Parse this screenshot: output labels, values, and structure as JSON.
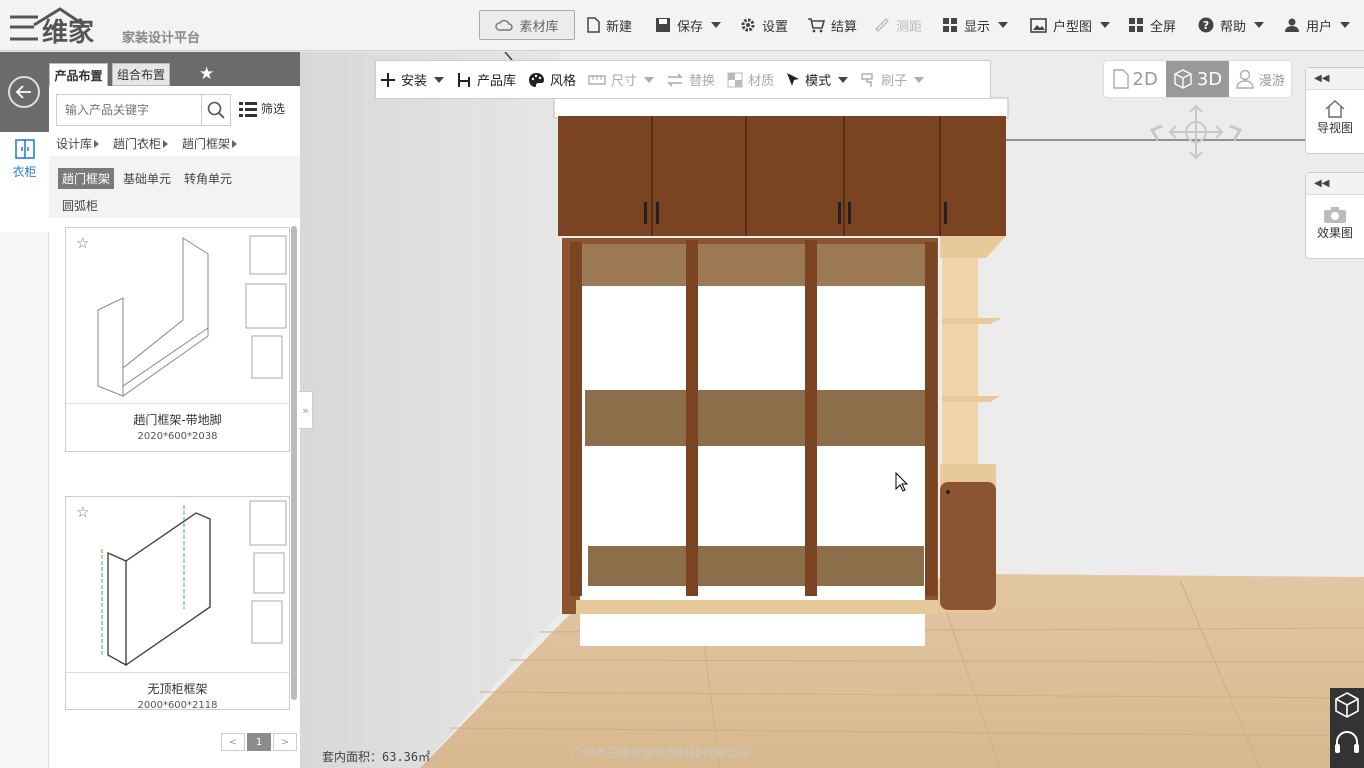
{
  "header": {
    "logo_text": "三维家",
    "slogan": "家装设计平台",
    "material_lib": "素材库",
    "new": "新建",
    "save": "保存",
    "settings": "设置",
    "checkout": "结算",
    "measure": "测距",
    "display": "显示",
    "floorplan": "户型图",
    "fullscreen": "全屏",
    "help": "帮助",
    "user": "用户"
  },
  "left_strip": {
    "wardrobe": "衣柜"
  },
  "panel": {
    "tabs": [
      "产品布置",
      "组合布置"
    ],
    "search_placeholder": "输入产品关键字",
    "filter": "筛选",
    "breadcrumb": [
      "设计库",
      "趟门衣柜",
      "趟门框架"
    ],
    "categories": [
      "趟门框架",
      "基础单元",
      "转角单元",
      "圆弧柜"
    ],
    "active_category": "趟门框架",
    "products": [
      {
        "name": "趟门框架-带地脚",
        "dims": "2020*600*2038"
      },
      {
        "name": "无顶柜框架",
        "dims": "2000*600*2118"
      }
    ],
    "page": "1"
  },
  "toolbar": {
    "install": "安装",
    "product_lib": "产品库",
    "style": "风格",
    "size": "尺寸",
    "replace": "替换",
    "material": "材质",
    "mode": "模式",
    "brush": "刷子"
  },
  "view_modes": {
    "v2d": "2D",
    "v3d": "3D",
    "roam": "漫游",
    "active": "3D"
  },
  "side_panels": {
    "nav_view": "导视图",
    "render_view": "效果图"
  },
  "footer": {
    "area": "套内面积：63.36㎡",
    "watermark": "广州市三维家装信息科技有限公司"
  },
  "colors": {
    "accent": "#2a7fd4",
    "panel_header": "#6b6b6b",
    "wood_dark": "#7a4322",
    "wood_light": "#e8c99a"
  }
}
